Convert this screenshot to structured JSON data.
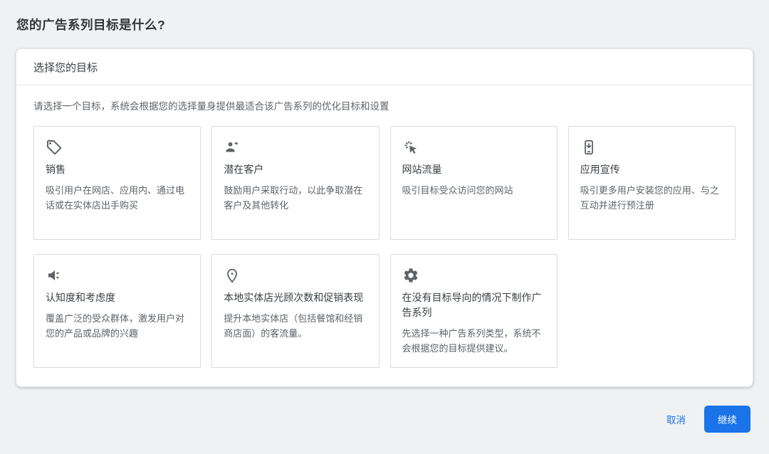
{
  "page": {
    "title": "您的广告系列目标是什么?"
  },
  "panel": {
    "header": "选择您的目标",
    "subtitle": "请选择一个目标，系统会根据您的选择量身提供最适合该广告系列的优化目标和设置"
  },
  "goals": [
    {
      "icon": "sell-tag-icon",
      "title": "销售",
      "description": "吸引用户在网店、应用内、通过电话或在实体店出手购买"
    },
    {
      "icon": "leads-person-icon",
      "title": "潜在客户",
      "description": "鼓励用户采取行动，以此争取潜在客户及其他转化"
    },
    {
      "icon": "ads-click-icon",
      "title": "网站流量",
      "description": "吸引目标受众访问您的网站"
    },
    {
      "icon": "install-mobile-icon",
      "title": "应用宣传",
      "description": "吸引更多用户安装您的应用、与之互动并进行预注册"
    },
    {
      "icon": "campaign-speaker-icon",
      "title": "认知度和考虑度",
      "description": "覆盖广泛的受众群体，激发用户对您的产品或品牌的兴趣"
    },
    {
      "icon": "location-pin-icon",
      "title": "本地实体店光顾次数和促销表现",
      "description": "提升本地实体店（包括餐馆和经销商店面）的客流量。"
    },
    {
      "icon": "gear-icon",
      "title": "在没有目标导向的情况下制作广告系列",
      "description": "先选择一种广告系列类型，系统不会根据您的目标提供建议。"
    }
  ],
  "footer": {
    "cancel_label": "取消",
    "continue_label": "继续"
  },
  "colors": {
    "accent_blue": "#1a73e8",
    "text_primary": "#3c4043",
    "text_secondary": "#5f6368",
    "card_border": "#dadce0",
    "page_background": "#f0f1f3",
    "panel_background": "#ffffff"
  }
}
